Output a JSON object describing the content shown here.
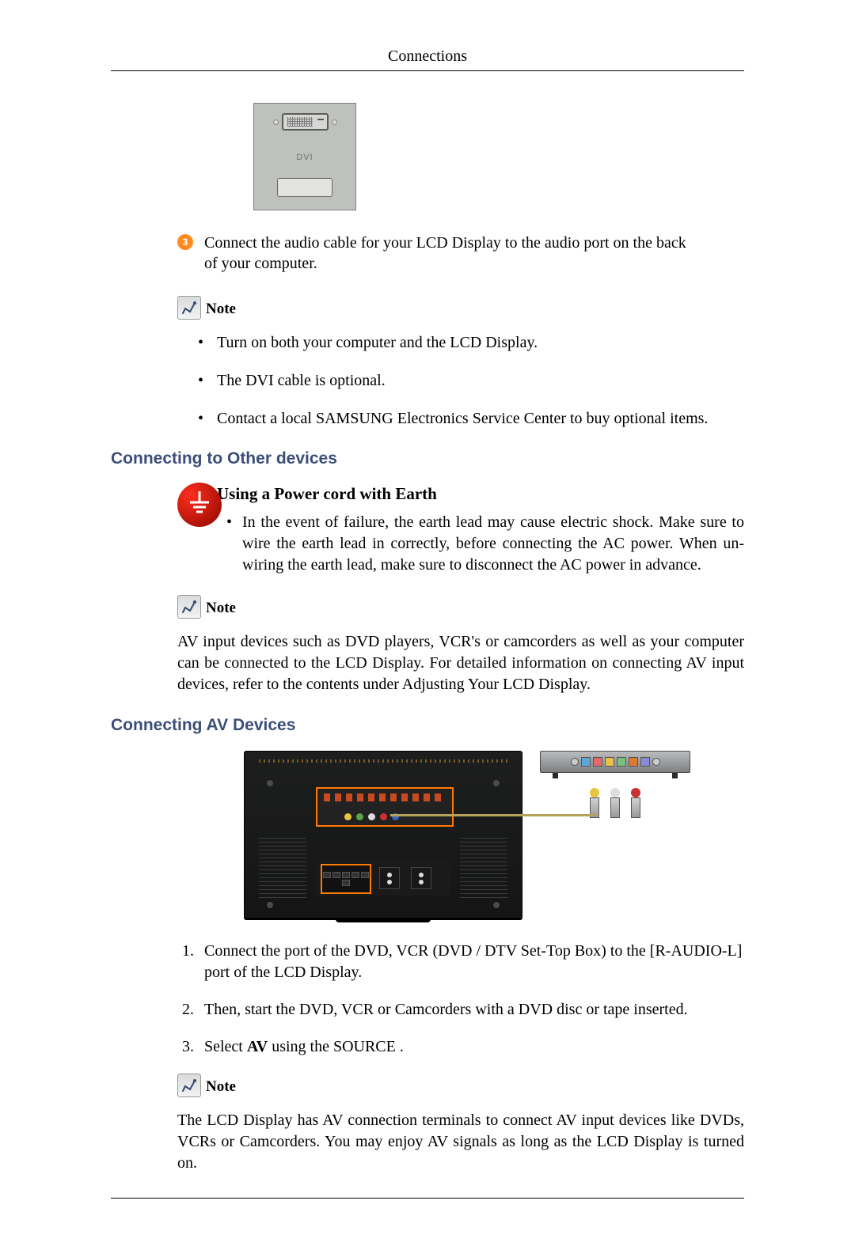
{
  "header": {
    "title": "Connections"
  },
  "dvi": {
    "label": "DVI"
  },
  "step3": {
    "number": "3",
    "text": "Connect the audio cable for your LCD Display to the audio port on the back of your computer."
  },
  "noteLabel": "Note",
  "notes1": [
    "Turn on both your computer and the LCD Display.",
    "The DVI cable is optional.",
    "Contact a local SAMSUNG Electronics Service Center to buy optional items."
  ],
  "section1": {
    "heading": "Connecting to Other devices",
    "earthHeading": "Using a Power cord with Earth",
    "earthBullet": "In the event of failure, the earth lead may cause electric shock. Make sure to wire the earth lead in correctly, before connecting the AC power. When un-wiring the earth lead, make sure to disconnect the AC power in advance."
  },
  "note2Para": "AV input devices such as DVD players, VCR's or camcorders as well as your computer can be connected to the LCD Display. For detailed information on connecting AV input devices, refer to the contents under Adjusting Your LCD Display.",
  "section2": {
    "heading": "Connecting AV Devices",
    "steps": [
      "Connect the port of the DVD, VCR (DVD / DTV Set-Top Box) to the [R-AUDIO-L] port of the LCD Display.",
      "Then, start the DVD, VCR or Camcorders with a DVD disc or tape inserted.",
      ""
    ],
    "step3_prefix": "Select ",
    "step3_bold": "AV",
    "step3_suffix": " using the SOURCE ."
  },
  "note3Para": "The LCD Display has AV connection terminals to connect AV input devices like DVDs, VCRs or Camcorders. You may enjoy AV signals as long as the LCD Display is turned on."
}
